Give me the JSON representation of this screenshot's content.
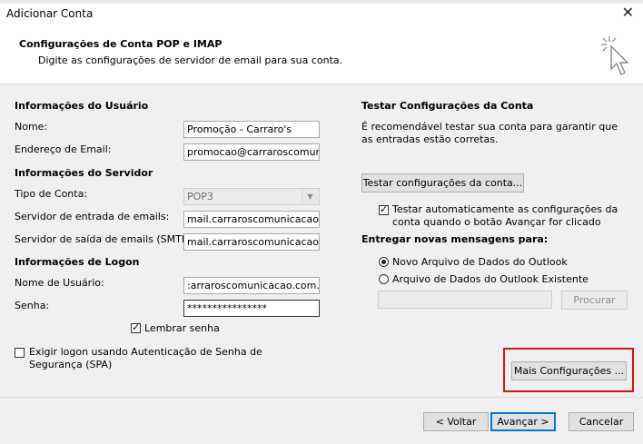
{
  "window": {
    "title": "Adicionar Conta",
    "close_glyph": "✕"
  },
  "header": {
    "title": "Configurações de Conta POP e IMAP",
    "subtitle": "Digite as configurações de servidor de email para sua conta.",
    "icon": "wizard-cursor-icon"
  },
  "user_info": {
    "section": "Informações do Usuário",
    "name_label": "Nome:",
    "name_value": "Promoção - Carraro's",
    "email_label": "Endereço de Email:",
    "email_value": "promocao@carraroscomunicacao.com.br"
  },
  "server_info": {
    "section": "Informações do Servidor",
    "account_type_label": "Tipo de Conta:",
    "account_type_value": "POP3",
    "incoming_label": "Servidor de entrada de emails:",
    "incoming_value": "mail.carraroscomunicacao.com.br",
    "outgoing_label": "Servidor de saída de emails (SMTP):",
    "outgoing_value": "mail.carraroscomunicacao.com.br"
  },
  "logon_info": {
    "section": "Informações de Logon",
    "username_label": "Nome de Usuário:",
    "username_value": ":arraroscomunicacao.com.br",
    "password_label": "Senha:",
    "password_value": "****************",
    "remember_label": "Lembrar senha",
    "remember_checked": true,
    "spa_label": "Exigir logon usando Autenticação de Senha de Segurança (SPA)",
    "spa_checked": false
  },
  "test": {
    "section": "Testar Configurações da Conta",
    "description": "É recomendável testar sua conta para garantir que as entradas estão corretas.",
    "test_button": "Testar configurações da conta...",
    "auto_test_label": "Testar automaticamente as configurações da conta quando o botão Avançar for clicado",
    "auto_test_checked": true
  },
  "delivery": {
    "section": "Entregar novas mensagens para:",
    "option_new": "Novo Arquivo de Dados do Outlook",
    "option_existing": "Arquivo de Dados do Outlook Existente",
    "selected": "new",
    "existing_path": "",
    "browse_button": "Procurar"
  },
  "more_settings_button": "Mais Configurações ...",
  "footer": {
    "back": "< Voltar",
    "next": "Avançar >",
    "cancel": "Cancelar"
  },
  "colors": {
    "highlight": "#e01010",
    "primary_border": "#0078d7"
  }
}
